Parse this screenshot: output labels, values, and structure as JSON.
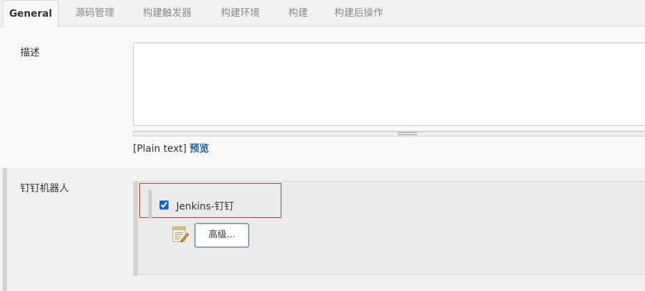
{
  "tabs": [
    {
      "label": "General",
      "active": true
    },
    {
      "label": "源码管理",
      "active": false
    },
    {
      "label": "构建触发器",
      "active": false
    },
    {
      "label": "构建环境",
      "active": false
    },
    {
      "label": "构建",
      "active": false
    },
    {
      "label": "构建后操作",
      "active": false
    }
  ],
  "description": {
    "label": "描述",
    "value": "",
    "syntax_label": "[Plain text]",
    "preview_link": "预览"
  },
  "dingtalk": {
    "section_label": "钉钉机器人",
    "robots": [
      {
        "name": "Jenkins-钉钉",
        "checked": true
      }
    ],
    "advanced_button": "高级...",
    "advanced_icon": "notepad-icon"
  },
  "colors": {
    "link": "#20629d",
    "highlight_border": "#d32f2f",
    "checkbox": "#0a64d6"
  }
}
